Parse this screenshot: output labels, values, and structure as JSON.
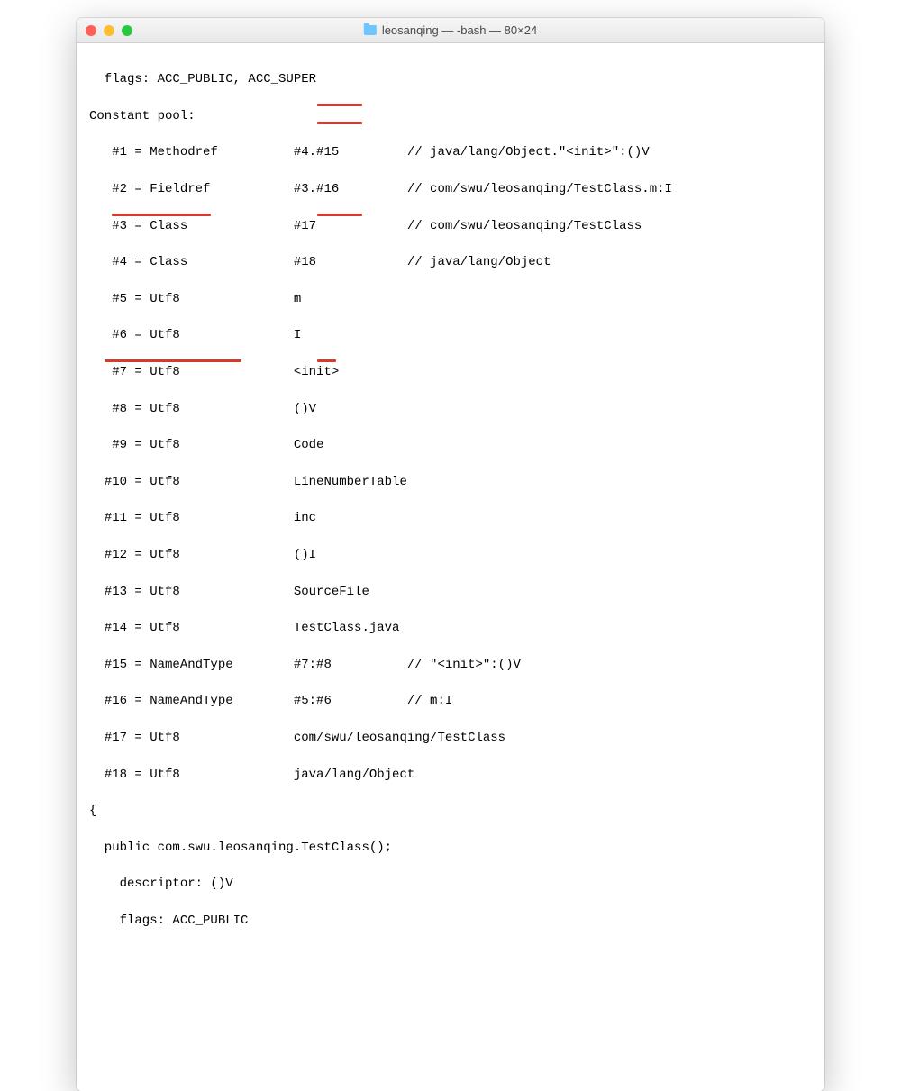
{
  "window": {
    "title": "leosanqing — -bash — 80×24"
  },
  "terminal": {
    "l0": "  flags: ACC_PUBLIC, ACC_SUPER",
    "l1": "Constant pool:",
    "l2": "   #1 = Methodref          #4.#15         // java/lang/Object.\"<init>\":()V",
    "l3": "   #2 = Fieldref           #3.#16         // com/swu/leosanqing/TestClass.m:I",
    "l4": "   #3 = Class              #17            // com/swu/leosanqing/TestClass",
    "l5": "   #4 = Class              #18            // java/lang/Object",
    "l6": "   #5 = Utf8               m",
    "l7": "   #6 = Utf8               I",
    "l8": "   #7 = Utf8               <init>",
    "l9": "   #8 = Utf8               ()V",
    "l10": "   #9 = Utf8               Code",
    "l11": "  #10 = Utf8               LineNumberTable",
    "l12": "  #11 = Utf8               inc",
    "l13": "  #12 = Utf8               ()I",
    "l14": "  #13 = Utf8               SourceFile",
    "l15": "  #14 = Utf8               TestClass.java",
    "l16": "  #15 = NameAndType        #7:#8          // \"<init>\":()V",
    "l17": "  #16 = NameAndType        #5:#6          // m:I",
    "l18": "  #17 = Utf8               com/swu/leosanqing/TestClass",
    "l19": "  #18 = Utf8               java/lang/Object",
    "l20": "{",
    "l21": "  public com.swu.leosanqing.TestClass();",
    "l22": "    descriptor: ()V",
    "l23": "    flags: ACC_PUBLIC"
  },
  "annotations": {
    "u1": {
      "top_line": 2,
      "left_ch": 30,
      "width_ch": 6
    },
    "u2": {
      "top_line": 3,
      "left_ch": 30,
      "width_ch": 6
    },
    "u3": {
      "top_line": 8,
      "left_ch": 3,
      "width_ch": 13
    },
    "u4": {
      "top_line": 8,
      "left_ch": 30,
      "width_ch": 6
    },
    "u5": {
      "top_line": 16,
      "left_ch": 30,
      "width_ch": 2.5
    },
    "u6": {
      "top_line": 16,
      "left_ch": 2,
      "width_ch": 18
    }
  }
}
